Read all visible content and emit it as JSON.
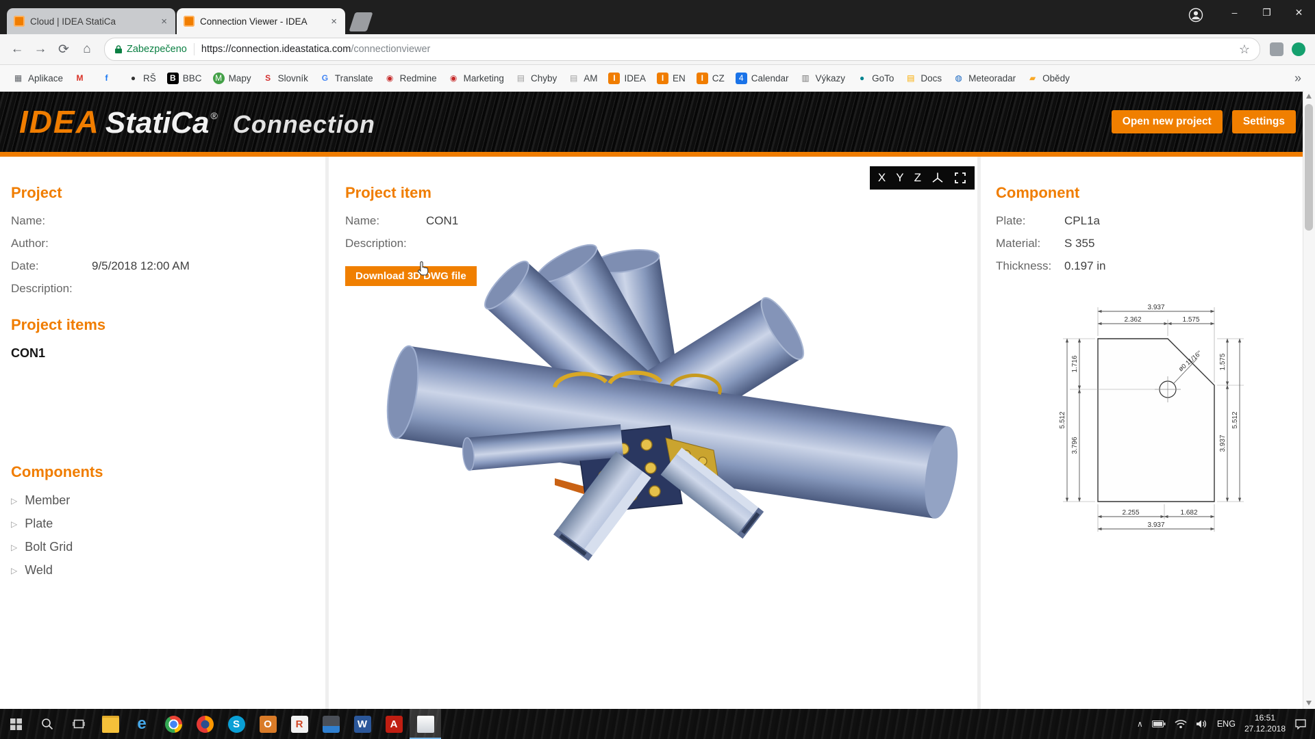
{
  "browser": {
    "tabs": [
      {
        "title": "Cloud | IDEA StatiCa",
        "close": "×"
      },
      {
        "title": "Connection Viewer - IDEA",
        "close": "×"
      }
    ],
    "window": {
      "minimize": "–",
      "maximize": "❐",
      "close": "✕"
    },
    "nav": {
      "back": "←",
      "forward": "→",
      "reload": "⟳",
      "home": "⌂",
      "secure_label": "Zabezpečeno",
      "url_domain": "https://connection.ideastatica.com",
      "url_path": "/connectionviewer",
      "star": "☆"
    },
    "bookmarks_overflow": "»",
    "bookmarks": [
      {
        "label": "Aplikace",
        "glyph": "▦",
        "style": "color:#5f6368"
      },
      {
        "label": "",
        "glyph": "M",
        "style": "color:#d93025;font-weight:bold"
      },
      {
        "label": "",
        "glyph": "f",
        "style": "color:#1877f2;font-weight:bold"
      },
      {
        "label": "RŠ",
        "glyph": "●",
        "style": "color:#333"
      },
      {
        "label": "BBC",
        "glyph": "B",
        "style": "background:#000;color:#fff;font-weight:bold"
      },
      {
        "label": "Mapy",
        "glyph": "M",
        "style": "background:#43a047;color:#fff;border-radius:50%"
      },
      {
        "label": "Slovník",
        "glyph": "S",
        "style": "color:#d32f2f;font-weight:bold"
      },
      {
        "label": "Translate",
        "glyph": "G",
        "style": "color:#4285f4;font-weight:bold"
      },
      {
        "label": "Redmine",
        "glyph": "◉",
        "style": "color:#c62828"
      },
      {
        "label": "Marketing",
        "glyph": "◉",
        "style": "color:#c62828"
      },
      {
        "label": "Chyby",
        "glyph": "▤",
        "style": "color:#9e9e9e"
      },
      {
        "label": "AM",
        "glyph": "▤",
        "style": "color:#9e9e9e"
      },
      {
        "label": "IDEA",
        "glyph": "I",
        "style": "background:#f07d00;color:#fff;font-weight:bold"
      },
      {
        "label": "EN",
        "glyph": "I",
        "style": "background:#f07d00;color:#fff;font-weight:bold"
      },
      {
        "label": "CZ",
        "glyph": "I",
        "style": "background:#f07d00;color:#fff;font-weight:bold"
      },
      {
        "label": "Calendar",
        "glyph": "4",
        "style": "background:#1a73e8;color:#fff"
      },
      {
        "label": "Výkazy",
        "glyph": "▥",
        "style": "color:#757575"
      },
      {
        "label": "GoTo",
        "glyph": "●",
        "style": "color:#00838f"
      },
      {
        "label": "Docs",
        "glyph": "▤",
        "style": "color:#f9ab00"
      },
      {
        "label": "Meteoradar",
        "glyph": "◍",
        "style": "color:#1565c0"
      },
      {
        "label": "Obědy",
        "glyph": "▰",
        "style": "color:#f9a825"
      }
    ]
  },
  "header": {
    "logo_idea": "IDEA",
    "logo_statica": "StatiCa",
    "logo_reg": "®",
    "logo_connection": "Connection",
    "btn_open": "Open new project",
    "btn_settings": "Settings"
  },
  "project": {
    "title": "Project",
    "name_label": "Name:",
    "name_value": "",
    "author_label": "Author:",
    "author_value": "",
    "date_label": "Date:",
    "date_value": "9/5/2018 12:00 AM",
    "desc_label": "Description:",
    "desc_value": "",
    "items_title": "Project items",
    "item": "CON1",
    "components_title": "Components",
    "expander": "▷",
    "components": [
      {
        "label": "Member"
      },
      {
        "label": "Plate"
      },
      {
        "label": "Bolt Grid"
      },
      {
        "label": "Weld"
      }
    ]
  },
  "project_item": {
    "title": "Project item",
    "name_label": "Name:",
    "name_value": "CON1",
    "desc_label": "Description:",
    "desc_value": "",
    "download_btn": "Download 3D DWG file",
    "axes": {
      "x": "X",
      "y": "Y",
      "z": "Z"
    }
  },
  "component": {
    "title": "Component",
    "plate_label": "Plate:",
    "plate_value": "CPL1a",
    "material_label": "Material:",
    "material_value": "S 355",
    "thickness_label": "Thickness:",
    "thickness_value": "0.197 in",
    "drawing": {
      "top_overall": "3.937",
      "top_left": "2.362",
      "top_right": "1.575",
      "left_overall": "5.512",
      "left_upper": "1.716",
      "left_lower": "3.796",
      "right_upper": "1.575",
      "right_lower": "3.937",
      "right_overall": "5.512",
      "bottom_left": "2.255",
      "bottom_right": "1.682",
      "bottom_overall": "3.937",
      "hole_label": "ø0 11/16''"
    }
  },
  "taskbar": {
    "tray_chevron": "∧",
    "lang": "ENG",
    "time": "16:51",
    "date": "27.12.2018",
    "apps": [
      {
        "glyph": "",
        "style": "background:#f5c13a;border-radius:2px;box-shadow:inset 0 3px 0 #e0a92a"
      },
      {
        "glyph": "e",
        "style": "color:#46a9ea;font-size:24px;font-weight:bold"
      },
      {
        "glyph": "",
        "style": "border-radius:50%;background:radial-gradient(circle,#4285f4 0 30%,#fff 30% 41%,rgba(0,0,0,0) 41%),conic-gradient(from -30deg,#ea4335 0 120deg,#fbbc05 120deg 200deg,#34a853 200deg 360deg)"
      },
      {
        "glyph": "",
        "style": "border-radius:50%;background:radial-gradient(circle,#2b4f8e 0 34%,rgba(0,0,0,0) 34%),conic-gradient(#ff9800 0 160deg,#e53935 160deg 360deg)"
      },
      {
        "glyph": "S",
        "style": "background:#0aa0d6;border-radius:50%"
      },
      {
        "glyph": "O",
        "style": "background:#d97b28;border-radius:3px"
      },
      {
        "glyph": "R",
        "style": "background:#f2f2f2;color:#d24726;border-radius:3px"
      },
      {
        "glyph": "",
        "style": "background:linear-gradient(#4a4f58 60%,#2f7fd0 60%);border-radius:3px"
      },
      {
        "glyph": "W",
        "style": "background:#2b579a;border-radius:3px"
      },
      {
        "glyph": "A",
        "style": "background:#c01e12;border-radius:3px"
      },
      {
        "glyph": "",
        "style": "background:linear-gradient(#fdfdfd,#cfd4da);border-radius:2px"
      }
    ]
  },
  "colors": {
    "accent_orange": "#f07d00",
    "secure_green": "#0b8043"
  }
}
